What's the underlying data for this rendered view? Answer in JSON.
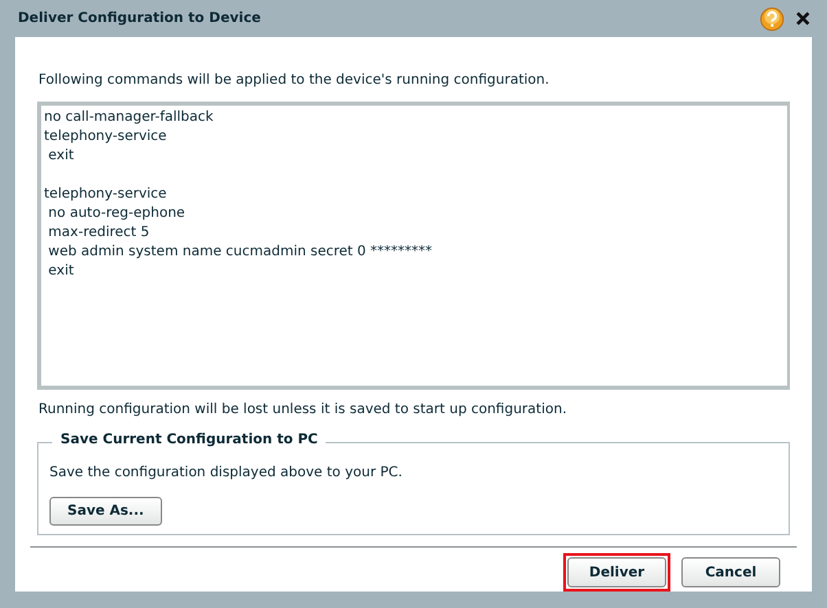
{
  "dialog": {
    "title": "Deliver Configuration to Device",
    "intro": "Following commands will be applied to the device's running configuration.",
    "command_blocks": [
      [
        "no call-manager-fallback",
        "telephony-service",
        " exit"
      ],
      [
        "telephony-service",
        " no auto-reg-ephone",
        " max-redirect 5",
        " web admin system name cucmadmin secret 0 *********",
        " exit"
      ]
    ],
    "warning": "Running configuration will be lost unless it is saved to start up configuration.",
    "save_group": {
      "legend": "Save Current Configuration to PC",
      "text": "Save the configuration displayed above to your PC.",
      "button": "Save As..."
    },
    "buttons": [
      {
        "label": "Deliver",
        "focused": true
      },
      {
        "label": "Cancel",
        "focused": false
      }
    ]
  }
}
